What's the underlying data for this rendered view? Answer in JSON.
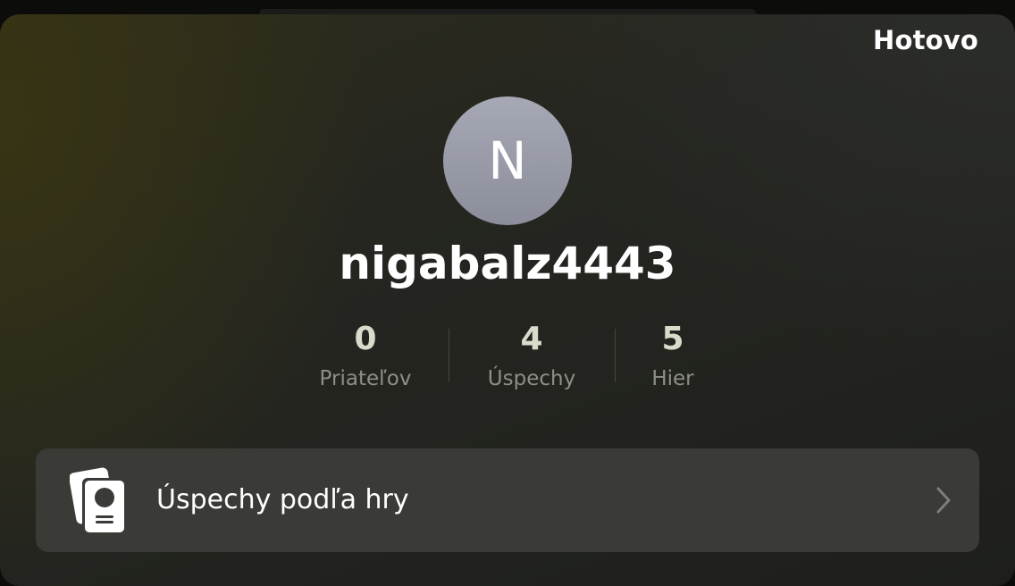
{
  "header": {
    "done_label": "Hotovo"
  },
  "profile": {
    "avatar_initial": "N",
    "username": "nigabalz4443"
  },
  "stats": [
    {
      "value": "0",
      "label": "Priateľov"
    },
    {
      "value": "4",
      "label": "Úspechy"
    },
    {
      "value": "5",
      "label": "Hier"
    }
  ],
  "achievements_row": {
    "label": "Úspechy podľa hry",
    "icon": "achievement-cards-icon",
    "chevron_icon": "chevron-right-icon"
  },
  "colors": {
    "accent_text": "#ffffff",
    "stat_value": "#d9dccb",
    "stat_label": "#8d8f86",
    "row_background": "#3a3a37",
    "avatar": "#9a9da9"
  }
}
